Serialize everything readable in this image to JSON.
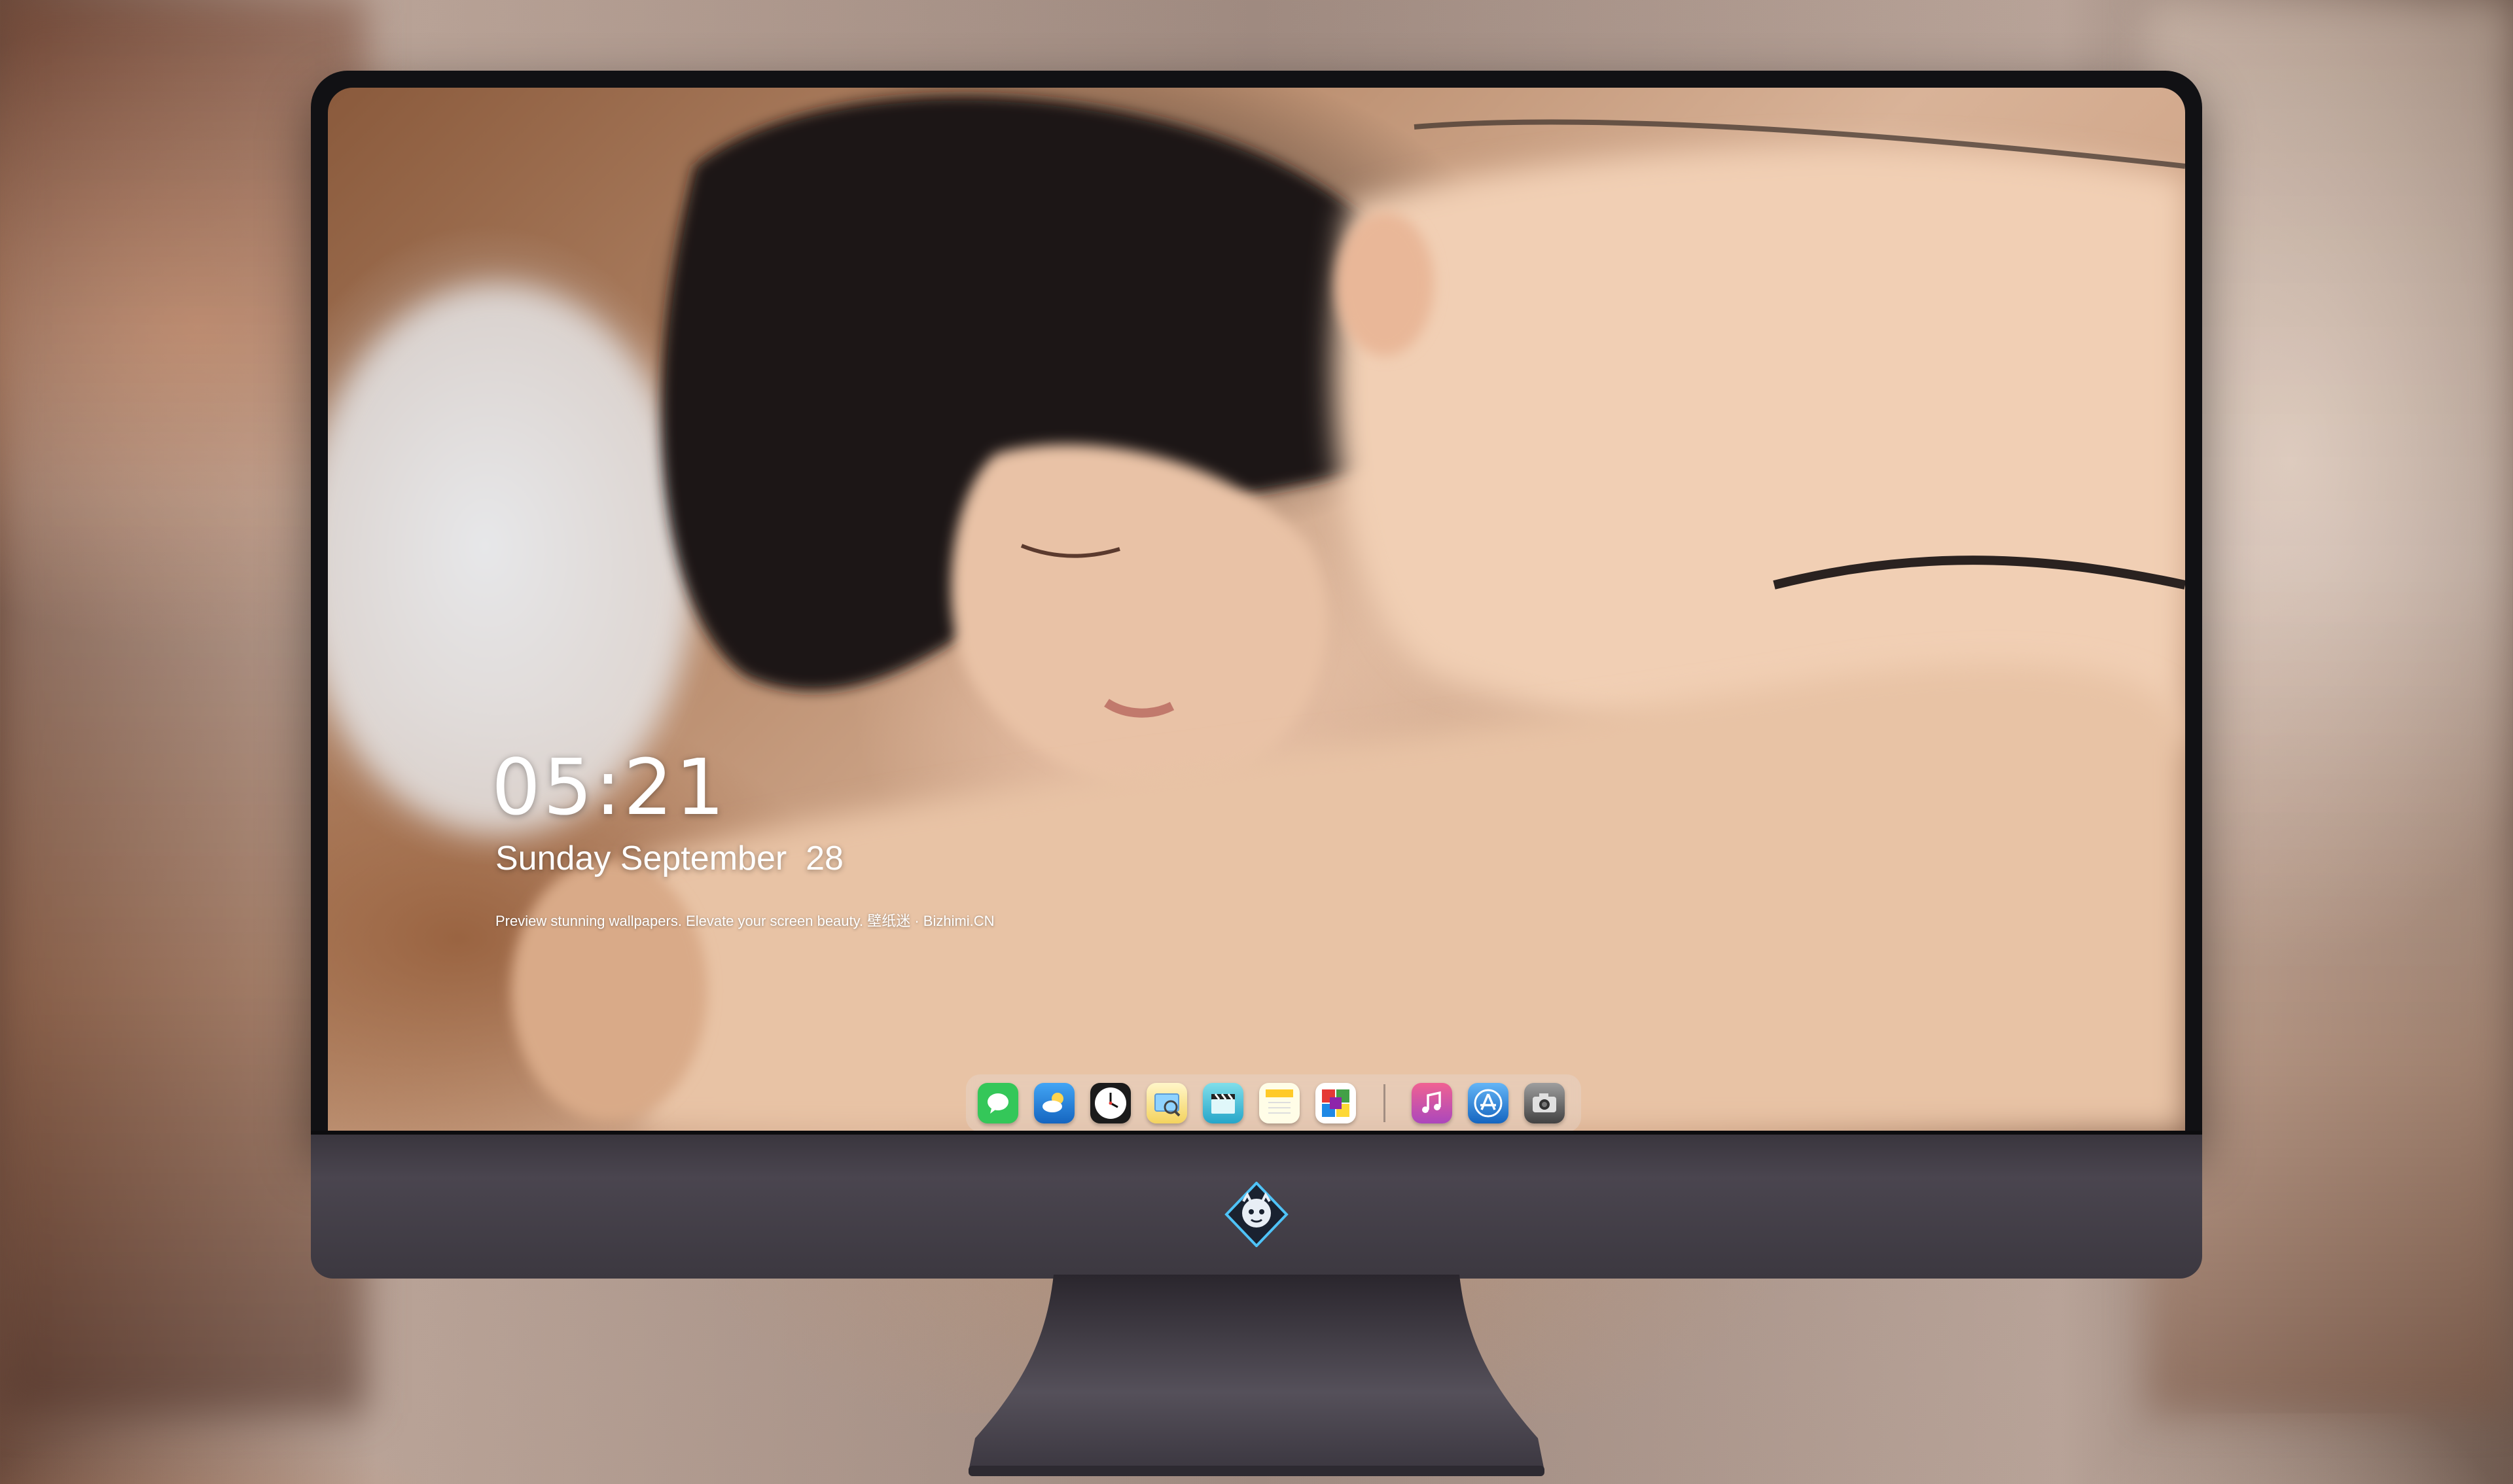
{
  "lock_screen": {
    "time": "05:21",
    "date": "Sunday September  28",
    "tagline": "Preview stunning wallpapers. Elevate your screen beauty. 壁纸迷 · Bizhimi.CN"
  },
  "dock": {
    "apps": [
      {
        "name": "Messages",
        "icon": "messages-icon",
        "color": "#34c759"
      },
      {
        "name": "Weather",
        "icon": "weather-icon",
        "color": "#1e88e5"
      },
      {
        "name": "Clock",
        "icon": "clock-icon",
        "color": "#ffffff"
      },
      {
        "name": "Preview",
        "icon": "preview-icon",
        "color": "#f4d35e"
      },
      {
        "name": "Clips",
        "icon": "clapperboard-icon",
        "color": "#4fc3f7"
      },
      {
        "name": "Notes",
        "icon": "notes-icon",
        "color": "#ffd54f"
      },
      {
        "name": "Photo Booth",
        "icon": "photo-booth-icon",
        "color": "#e53935"
      },
      {
        "name": "iTunes",
        "icon": "music-icon",
        "color": "#e040fb"
      },
      {
        "name": "App Store",
        "icon": "app-store-icon",
        "color": "#1e88e5"
      },
      {
        "name": "Camera",
        "icon": "camera-icon",
        "color": "#616161"
      }
    ]
  },
  "monitor": {
    "chin_logo": "dragon-mascot-logo"
  }
}
